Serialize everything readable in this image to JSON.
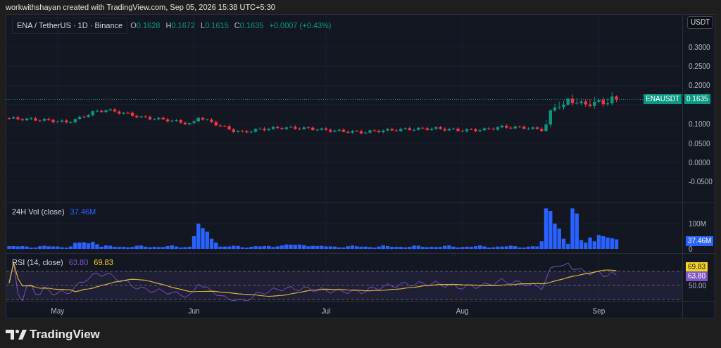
{
  "attribution": "workwithshayan created with TradingView.com, Sep 05, 2026 15:38 UTC+5:30",
  "legend": {
    "symbol": "ENA / TetherUS · 1D · Binance",
    "ohlc": [
      {
        "label": "O",
        "value": "0.1628"
      },
      {
        "label": "H",
        "value": "0.1672"
      },
      {
        "label": "L",
        "value": "0.1615"
      },
      {
        "label": "C",
        "value": "0.1635"
      }
    ],
    "change": "+0.0007 (+0.43%)"
  },
  "currency_button": "USDT",
  "price_axis": {
    "upper_ticks": [
      "0.3000",
      "0.2500",
      "0.2000"
    ],
    "lower_ticks": [
      "0.1000",
      "0.0500",
      "0.0000",
      "-0.0500"
    ]
  },
  "price_label": {
    "symbol": "ENAUSDT",
    "value": "0.1635"
  },
  "volume_pane": {
    "title": "24H Vol (close)",
    "value": "37.46M",
    "axis_ticks": [
      "100M",
      "0"
    ],
    "value_label": "37.46M"
  },
  "rsi_pane": {
    "title": "RSI (14, close)",
    "rsi_value": "63.80",
    "ma_value": "69.83",
    "ma_label": "69.83",
    "rsi_label": "63.80",
    "axis_ticks": [
      "50.00"
    ]
  },
  "time_axis": [
    "May",
    "Jun",
    "Jul",
    "Aug",
    "Sep"
  ],
  "logo": "TradingView"
}
